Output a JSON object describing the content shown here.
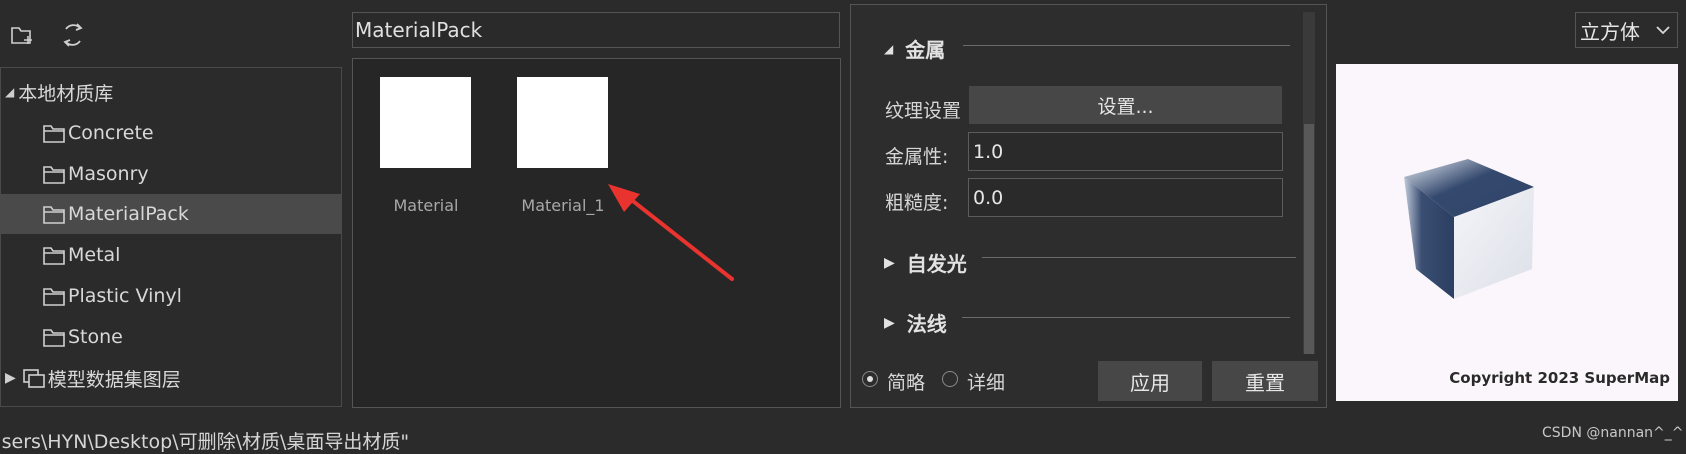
{
  "toolbar": {
    "new_folder_icon": "new-folder-icon",
    "refresh_icon": "refresh-icon"
  },
  "tree": {
    "root_label": "本地材质库",
    "items": [
      {
        "label": "Concrete"
      },
      {
        "label": "Masonry"
      },
      {
        "label": "MaterialPack"
      },
      {
        "label": "Metal"
      },
      {
        "label": "Plastic Vinyl"
      },
      {
        "label": "Stone"
      }
    ],
    "selected": "MaterialPack",
    "dataset_label": "模型数据集图层"
  },
  "path_bar": {
    "value": "MaterialPack"
  },
  "materials": [
    {
      "label": "Material"
    },
    {
      "label": "Material_1"
    }
  ],
  "properties": {
    "metal_section": "金属",
    "texture_label": "纹理设置",
    "texture_button": "设置...",
    "metallic_label": "金属性:",
    "metallic_value": "1.0",
    "roughness_label": "粗糙度:",
    "roughness_value": "0.0",
    "emissive_section": "自发光",
    "normal_section": "法线",
    "mode_simple": "简略",
    "mode_detail": "详细",
    "mode_selected": "简略",
    "apply_button": "应用",
    "reset_button": "重置"
  },
  "preview": {
    "shape_select": "立方体",
    "copyright": "Copyright 2023 SuperMap"
  },
  "status": {
    "path_text": "Jsers\\HYN\\Desktop\\可删除\\材质\\桌面导出材质\""
  },
  "watermark": "CSDN @nannan^_^",
  "colors": {
    "background": "#2b2b2b",
    "selected_row": "#4a4a4a",
    "annotation_arrow": "#e8332f",
    "cube_dark": "#34496e"
  }
}
